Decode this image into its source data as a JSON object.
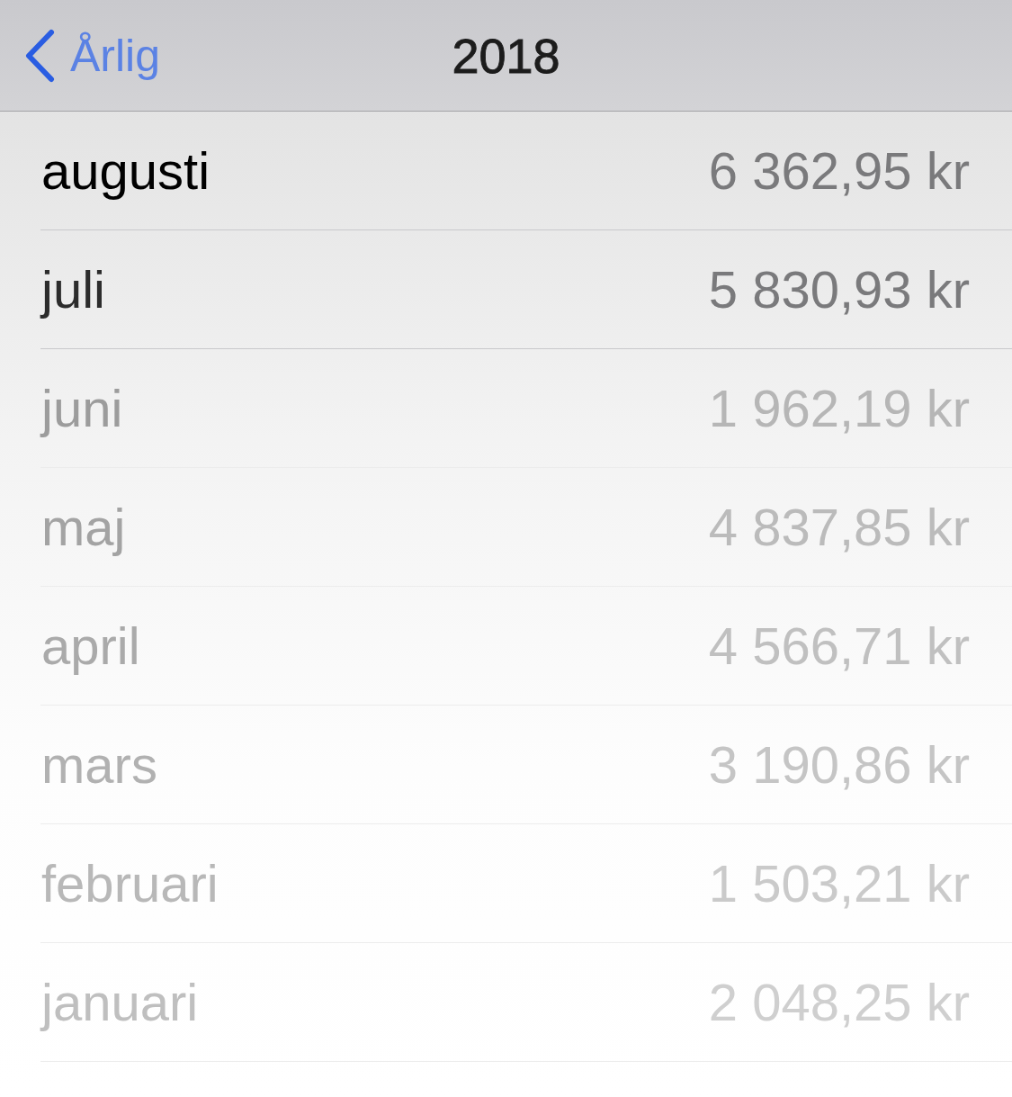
{
  "nav": {
    "back_label": "Årlig",
    "title": "2018"
  },
  "months": [
    {
      "name": "augusti",
      "amount": "6 362,95 kr",
      "blurred": false
    },
    {
      "name": "juli",
      "amount": "5 830,93 kr",
      "blurred": false
    },
    {
      "name": "juni",
      "amount": "1 962,19 kr",
      "blurred": true
    },
    {
      "name": "maj",
      "amount": "4 837,85 kr",
      "blurred": true
    },
    {
      "name": "april",
      "amount": "4 566,71 kr",
      "blurred": true
    },
    {
      "name": "mars",
      "amount": "3 190,86 kr",
      "blurred": true
    },
    {
      "name": "februari",
      "amount": "1 503,21 kr",
      "blurred": true
    },
    {
      "name": "januari",
      "amount": "2 048,25 kr",
      "blurred": true
    }
  ]
}
